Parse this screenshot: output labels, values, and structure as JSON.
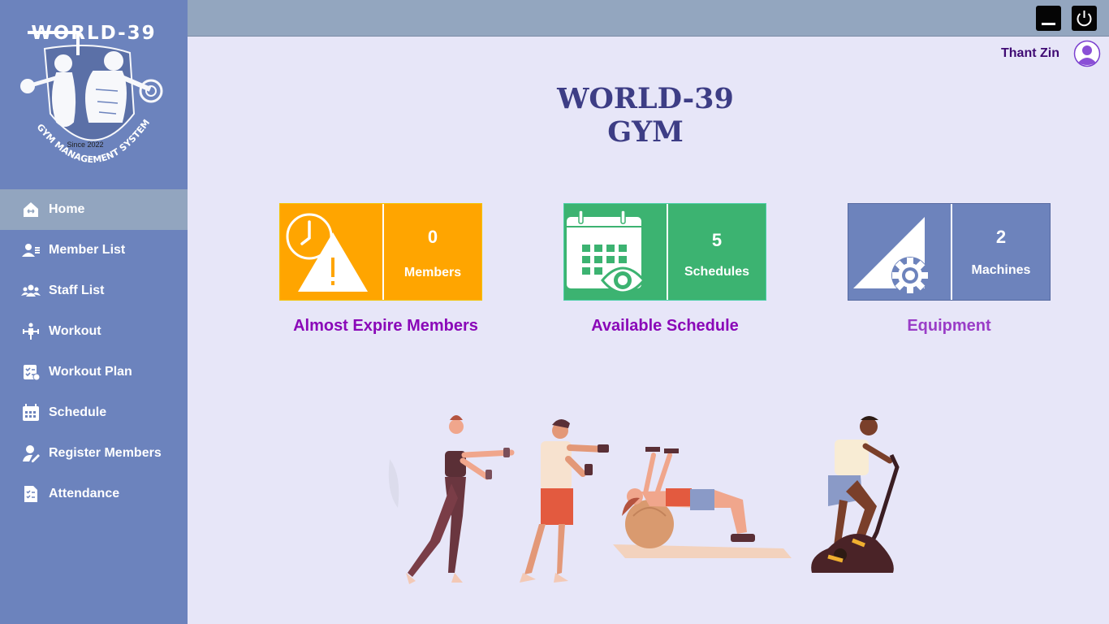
{
  "app": {
    "logo_title": "WORLD-39",
    "logo_since": "Since 2022",
    "logo_arc_text": "GYM MANAGEMENT SYSTEM"
  },
  "sidebar": {
    "items": [
      {
        "label": "Home",
        "icon": "home-icon",
        "active": true
      },
      {
        "label": "Member List",
        "icon": "member-list-icon"
      },
      {
        "label": "Staff List",
        "icon": "staff-list-icon"
      },
      {
        "label": "Workout",
        "icon": "workout-icon"
      },
      {
        "label": "Workout Plan",
        "icon": "workout-plan-icon"
      },
      {
        "label": "Schedule",
        "icon": "schedule-icon"
      },
      {
        "label": "Register Members",
        "icon": "register-members-icon"
      },
      {
        "label": "Attendance",
        "icon": "attendance-icon"
      }
    ]
  },
  "header": {
    "user_name": "Thant Zin",
    "minimize_icon": "minimize-icon",
    "power_icon": "power-icon"
  },
  "main": {
    "title": "WORLD-39  GYM",
    "cards": {
      "expire": {
        "value": "0",
        "label": "Members",
        "caption": "Almost Expire Members",
        "icon": "clock-warning-icon"
      },
      "schedule": {
        "value": "5",
        "label": "Schedules",
        "caption": "Available Schedule",
        "icon": "calendar-eye-icon"
      },
      "equipment": {
        "value": "2",
        "label": "Machines",
        "caption": "Equipment",
        "icon": "ramp-gear-icon"
      }
    }
  },
  "colors": {
    "sidebar": "#6c83bd",
    "active_item": "#92a5bf",
    "topbar": "#93a6bf",
    "background": "#e7e6f8",
    "card_expire": "#ffa500",
    "card_schedule": "#3cb371",
    "card_equipment": "#6d83bc",
    "caption": "#8a08b8",
    "title": "#3d3d85"
  }
}
